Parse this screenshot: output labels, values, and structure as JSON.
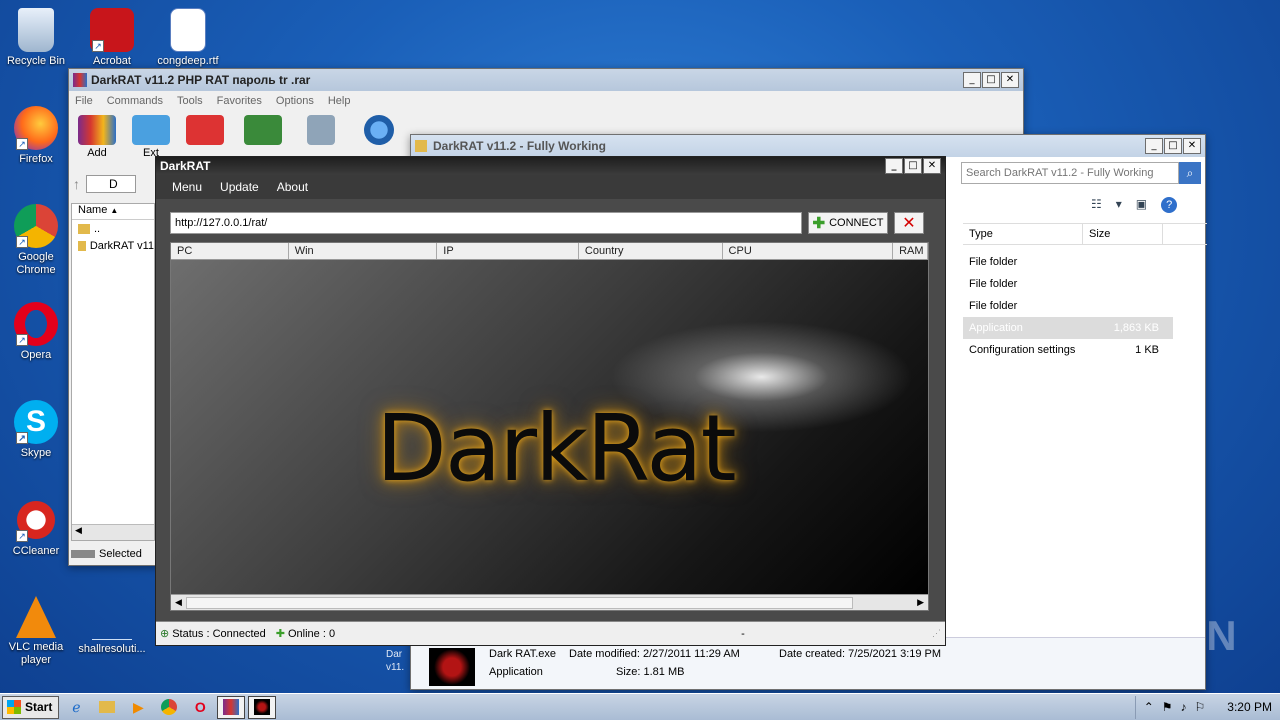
{
  "desktop": {
    "icons": [
      {
        "label": "Recycle Bin",
        "icon": "recycle-bin-icon"
      },
      {
        "label": "Acrobat",
        "icon": "acrobat-icon"
      },
      {
        "label": "congdeep.rtf",
        "icon": "word-doc-icon"
      },
      {
        "label": "Firefox",
        "icon": "firefox-icon"
      },
      {
        "label": "Google Chrome",
        "icon": "chrome-icon"
      },
      {
        "label": "Opera",
        "icon": "opera-icon"
      },
      {
        "label": "Skype",
        "icon": "skype-icon"
      },
      {
        "label": "CCleaner",
        "icon": "ccleaner-icon"
      },
      {
        "label": "VLC media player",
        "icon": "vlc-icon"
      },
      {
        "label": "shallresoluti...",
        "icon": "blank-file-icon"
      }
    ],
    "watermark": "ANY RUN"
  },
  "winrar": {
    "title": "DarkRAT v11.2 PHP RAT пароль tr .rar",
    "menu": [
      "File",
      "Commands",
      "Tools",
      "Favorites",
      "Options",
      "Help"
    ],
    "tools": [
      "Add",
      "Ext"
    ],
    "path_prefix": "D",
    "column_name": "Name",
    "items": [
      "..",
      "DarkRAT v11"
    ],
    "status": "Selected"
  },
  "explorer": {
    "title": "DarkRAT v11.2 - Fully Working",
    "search_placeholder": "Search DarkRAT v11.2 - Fully Working",
    "columns": {
      "type": "Type",
      "size": "Size"
    },
    "rows": [
      {
        "type": "File folder",
        "size": ""
      },
      {
        "type": "File folder",
        "size": ""
      },
      {
        "type": "File folder",
        "size": ""
      },
      {
        "type": "Application",
        "size": "1,863 KB"
      },
      {
        "type": "Configuration settings",
        "size": "1 KB"
      }
    ],
    "details": {
      "name": "Dark RAT.exe",
      "modified": "Date modified: 2/27/2011 11:29 AM",
      "created": "Date created: 7/25/2021 3:19 PM",
      "kind": "Application",
      "size": "Size: 1.81 MB"
    },
    "behind_label": "Dar v11."
  },
  "darkrat": {
    "title": "DarkRAT",
    "menu": [
      "Menu",
      "Update",
      "About"
    ],
    "url": "http://127.0.0.1/rat/",
    "connect_label": "CONNECT",
    "columns": [
      "PC",
      "Win",
      "IP",
      "Country",
      "CPU",
      "RAM"
    ],
    "logo_text": "DarkRat",
    "status": "Status : Connected",
    "online": "Online : 0",
    "status_dash": "-"
  },
  "taskbar": {
    "start_label": "Start",
    "clock": "3:20 PM"
  }
}
